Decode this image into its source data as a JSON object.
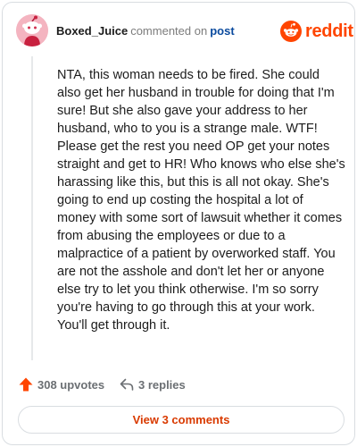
{
  "header": {
    "username": "Boxed_Juice",
    "commented_text": "commented on",
    "post_link": "post",
    "brand": "reddit"
  },
  "comment": {
    "body": "NTA, this woman needs to be fired. She could also get her husband in trouble for doing that I'm sure! But she also gave your address to her husband, who to you is a strange male. WTF! Please get the rest you need OP get your notes straight and get to HR! Who knows who else she's harassing like this, but this is all not okay. She's going to end up costing the hospital a lot of money with some sort of lawsuit whether it comes from abusing the employees or due to a malpractice of a patient by overworked staff. You are not the asshole and don't let her or anyone else try to let you think otherwise. I'm so sorry you're having to go through this at your work. You'll get through it."
  },
  "actions": {
    "upvotes_label": "308 upvotes",
    "replies_label": "3 replies",
    "view_comments_label": "View 3 comments"
  },
  "colors": {
    "brand": "#ff4500",
    "view_comments_text": "#d93a00",
    "avatar_bg": "#f4b4c0"
  },
  "icons": {
    "upvote": "upvote-arrow-icon",
    "reply": "reply-arrow-icon",
    "brand": "reddit-snoo-icon"
  }
}
